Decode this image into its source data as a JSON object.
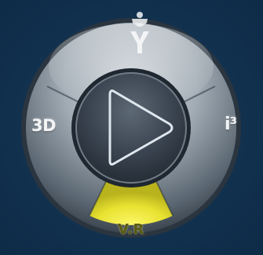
{
  "compass": {
    "left_label": "3D",
    "right_label": "i³",
    "bottom_label": "V.R",
    "center_icon": "play-icon",
    "top_icon": "person-icon",
    "colors": {
      "background": "#133352",
      "ring": "#9aa4ad",
      "ring_dark": "#4c5863",
      "center": "#3b4651",
      "active_segment": "#e7e23a",
      "text": "#f2f4f6"
    }
  }
}
